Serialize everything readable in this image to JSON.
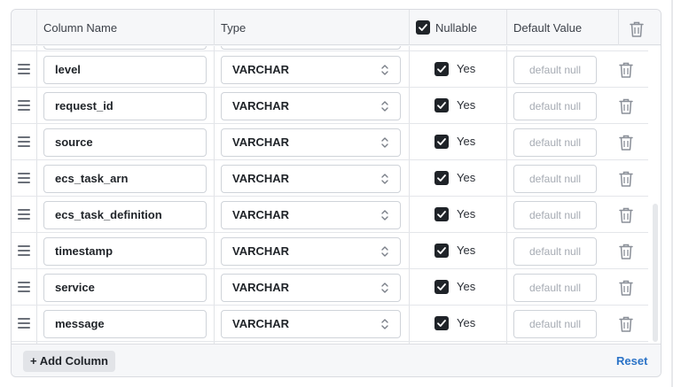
{
  "header": {
    "column_name": "Column Name",
    "type": "Type",
    "nullable": "Nullable",
    "default_value": "Default Value",
    "nullable_all_checked": true
  },
  "rows": [
    {
      "name": "level",
      "type": "VARCHAR",
      "nullable": true,
      "nullable_label": "Yes",
      "default_placeholder": "default null"
    },
    {
      "name": "request_id",
      "type": "VARCHAR",
      "nullable": true,
      "nullable_label": "Yes",
      "default_placeholder": "default null"
    },
    {
      "name": "source",
      "type": "VARCHAR",
      "nullable": true,
      "nullable_label": "Yes",
      "default_placeholder": "default null"
    },
    {
      "name": "ecs_task_arn",
      "type": "VARCHAR",
      "nullable": true,
      "nullable_label": "Yes",
      "default_placeholder": "default null"
    },
    {
      "name": "ecs_task_definition",
      "type": "VARCHAR",
      "nullable": true,
      "nullable_label": "Yes",
      "default_placeholder": "default null"
    },
    {
      "name": "timestamp",
      "type": "VARCHAR",
      "nullable": true,
      "nullable_label": "Yes",
      "default_placeholder": "default null"
    },
    {
      "name": "service",
      "type": "VARCHAR",
      "nullable": true,
      "nullable_label": "Yes",
      "default_placeholder": "default null"
    },
    {
      "name": "message",
      "type": "VARCHAR",
      "nullable": true,
      "nullable_label": "Yes",
      "default_placeholder": "default null"
    }
  ],
  "footer": {
    "add_column": "+ Add Column",
    "reset": "Reset"
  },
  "icons": {
    "drag": "drag-handle-icon",
    "select": "chevron-updown-icon",
    "delete": "trash-icon"
  },
  "colors": {
    "accent": "#2b73c7",
    "checkbox": "#1f2328"
  }
}
